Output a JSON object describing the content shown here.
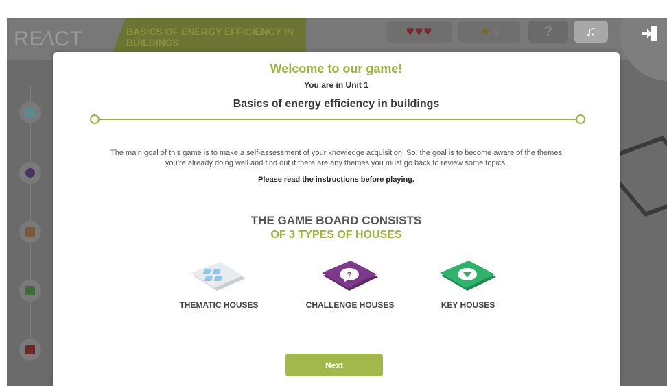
{
  "header": {
    "logo": "RE⁄\\CT",
    "unit_tab": "BASICS OF ENERGY EFFICIENCY IN BUILDINGS",
    "lives": "♥♥♥",
    "stars_count": "0",
    "help_label": "?",
    "music_label": "♫"
  },
  "modal": {
    "welcome": "Welcome to our game!",
    "unit_line": "You are in Unit 1",
    "unit_name": "Basics of energy efficiency in buildings",
    "intro": "The main goal of this game is to make a self-assessment of your knowledge acquisition. So, the goal is to become aware of the themes you’re already doing well and find out if there are any themes you must go back to review some topics.",
    "read_note": "Please read the instructions before playing.",
    "board_title_1": "THE GAME BOARD CONSISTS",
    "board_title_2": "OF 3 TYPES OF HOUSES",
    "houses": [
      {
        "label": "THEMATIC HOUSES",
        "icon": "thematic-house-icon",
        "color": "#e4e8ea"
      },
      {
        "label": "CHALLENGE HOUSES",
        "icon": "challenge-house-icon",
        "color": "#7e3a8a"
      },
      {
        "label": "KEY HOUSES",
        "icon": "key-house-icon",
        "color": "#2fb36a"
      }
    ],
    "next_label": "Next"
  },
  "colors": {
    "accent_green": "#9bb23c",
    "button_green": "#a3b84a",
    "challenge_purple": "#7e3a8a",
    "key_green": "#2fb36a"
  }
}
